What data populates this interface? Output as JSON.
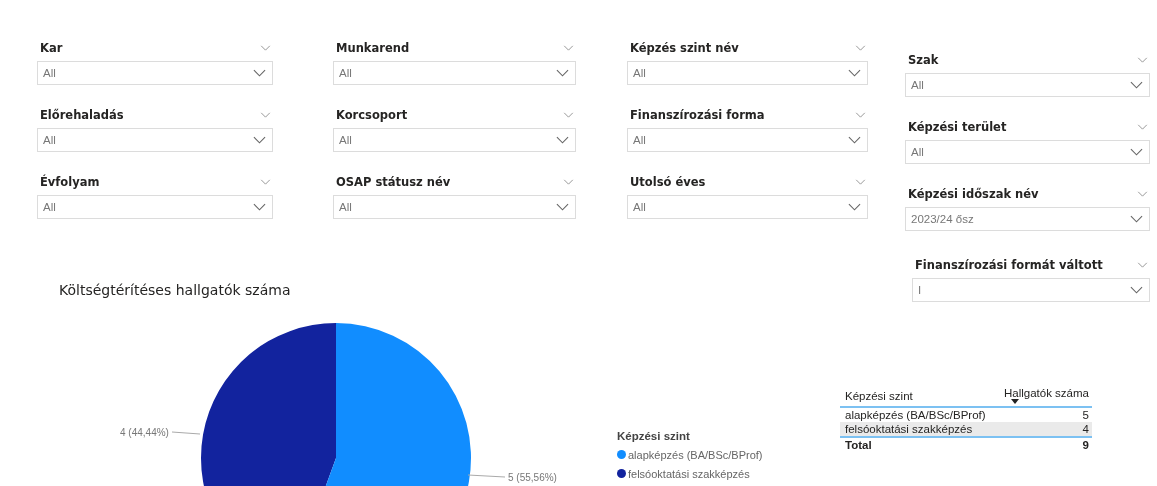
{
  "slicer_columns": [
    [
      {
        "label": "Kar",
        "value": "All"
      },
      {
        "label": "Előrehaladás",
        "value": "All"
      },
      {
        "label": "Évfolyam",
        "value": "All"
      }
    ],
    [
      {
        "label": "Munkarend",
        "value": "All"
      },
      {
        "label": "Korcsoport",
        "value": "All"
      },
      {
        "label": "OSAP státusz név",
        "value": "All"
      }
    ],
    [
      {
        "label": "Képzés szint név",
        "value": "All"
      },
      {
        "label": "Finanszírozási forma",
        "value": "All"
      },
      {
        "label": "Utolsó éves",
        "value": "All"
      }
    ],
    [
      {
        "label": "Szak",
        "value": "All"
      },
      {
        "label": "Képzési terület",
        "value": "All"
      },
      {
        "label": "Képzési időszak név",
        "value": "2023/24 ősz"
      },
      {
        "label": "Finanszírozási formát váltott",
        "value": "I"
      }
    ]
  ],
  "chart": {
    "chart_data": {
      "type": "pie",
      "title": "Költségtérítéses hallgatók száma",
      "categories": [
        "alapképzés (BA/BSc/BProf)",
        "felsóoktatási szakképzés"
      ],
      "values": [
        5,
        4
      ],
      "colors": [
        "#118dff",
        "#12239e"
      ],
      "value_labels": [
        "5 (55,56%)",
        "4 (44,44%)"
      ]
    },
    "legend_title": "Képzési szint"
  },
  "table": {
    "columns": [
      {
        "label": "Képzési szint",
        "sorted": false
      },
      {
        "label": "Hallgatók száma",
        "sorted": true
      }
    ],
    "rows": [
      [
        "alapképzés (BA/BSc/BProf)",
        "5"
      ],
      [
        "felsóoktatási szakképzés",
        "4"
      ]
    ],
    "total": [
      "Total",
      "9"
    ]
  }
}
